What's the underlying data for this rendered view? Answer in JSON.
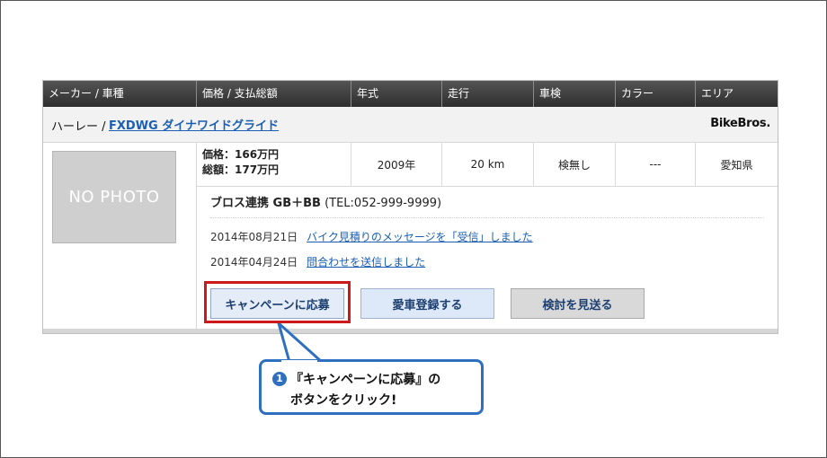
{
  "table": {
    "headers": [
      "メーカー / 車種",
      "価格 / 支払総額",
      "年式",
      "走行",
      "車検",
      "カラー",
      "エリア"
    ]
  },
  "listing": {
    "maker": "ハーレー /",
    "model": "FXDWG ダイナワイドグライド",
    "brand": "BikeBros.",
    "photo_placeholder": "NO PHOTO",
    "price": "価格：166万円",
    "total": "総額：177万円",
    "year": "2009年",
    "mileage": "20 km",
    "inspection": "検無し",
    "color": "---",
    "area": "愛知県",
    "dealer_name": "ブロス連携 GB＋BB",
    "dealer_tel": " (TEL:052-999-9999)",
    "history": [
      {
        "date": "2014年08月21日",
        "text": "バイク見積りのメッセージを「受信」しました"
      },
      {
        "date": "2014年04月24日",
        "text": "問合わせを送信しました"
      }
    ],
    "buttons": {
      "apply": "キャンペーンに応募",
      "register": "愛車登録する",
      "skip": "検討を見送る"
    }
  },
  "callout": {
    "number": "1",
    "line1": "『キャンペーンに応募』の",
    "line2": "ボタンをクリック!"
  },
  "colors": {
    "highlight": "#cc1a1a",
    "callout_border": "#2f6fc0",
    "link": "#1a5fb4"
  }
}
